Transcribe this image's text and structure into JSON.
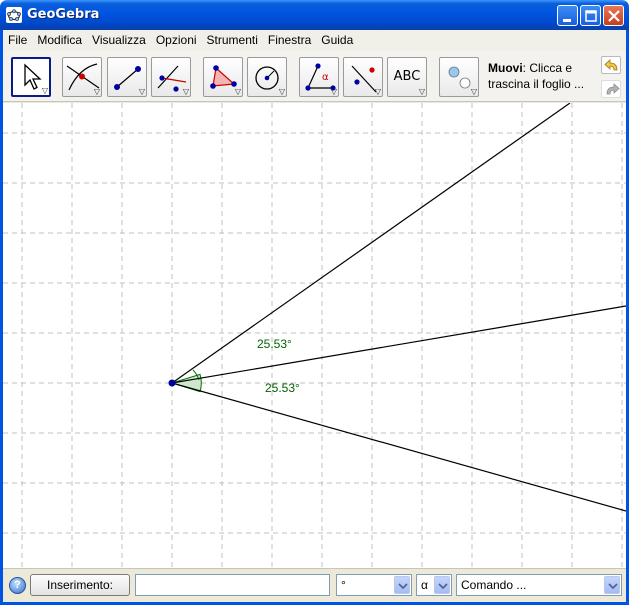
{
  "window": {
    "title": "GeoGebra"
  },
  "menu": [
    "File",
    "Modifica",
    "Visualizza",
    "Opzioni",
    "Strumenti",
    "Finestra",
    "Guida"
  ],
  "toolbar": {
    "abc_label": "ABC",
    "help_title": "Muovi",
    "help_text": ": Clicca e trascina il foglio ..."
  },
  "graphics": {
    "angle_labels": [
      "25.53°",
      "25.53°"
    ],
    "label_color": "#006400",
    "point_color": "#0000a0"
  },
  "inputbar": {
    "help_glyph": "?",
    "button_label": "Inserimento:",
    "input_value": "",
    "degree_symbol": "°",
    "greek_symbol": "α",
    "command_placeholder": "Comando ..."
  }
}
